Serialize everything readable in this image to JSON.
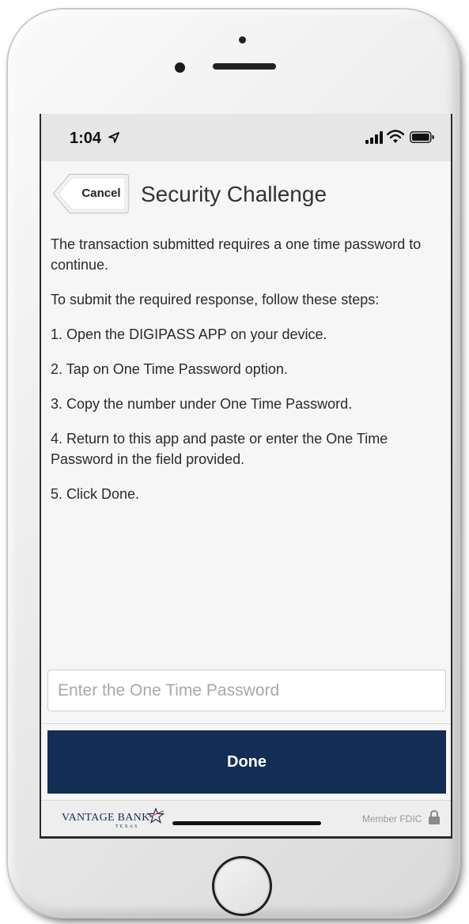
{
  "status_bar": {
    "time": "1:04",
    "icons": [
      "location-arrow-icon",
      "cellular-signal-icon",
      "wifi-icon",
      "battery-icon"
    ]
  },
  "header": {
    "cancel_label": "Cancel",
    "title": "Security Challenge"
  },
  "instructions": {
    "intro": "The transaction submitted requires a one time password to continue.",
    "lead": "To submit the required response, follow these steps:",
    "steps": [
      "1. Open the DIGIPASS APP on your device.",
      "2. Tap on One Time Password option.",
      "3. Copy the number under One Time Password.",
      "4. Return to this app and paste or enter the One Time Password in the field provided.",
      "5. Click Done."
    ]
  },
  "otp_field": {
    "placeholder": "Enter the One Time Password",
    "value": ""
  },
  "done_label": "Done",
  "footer": {
    "brand": "VANTAGE BANK",
    "brand_sub": "TEXAS",
    "fdic": "Member FDIC"
  },
  "colors": {
    "primary_button": "#132d55",
    "brand": "#1c2f55",
    "screen_background": "#f6f6f6"
  }
}
